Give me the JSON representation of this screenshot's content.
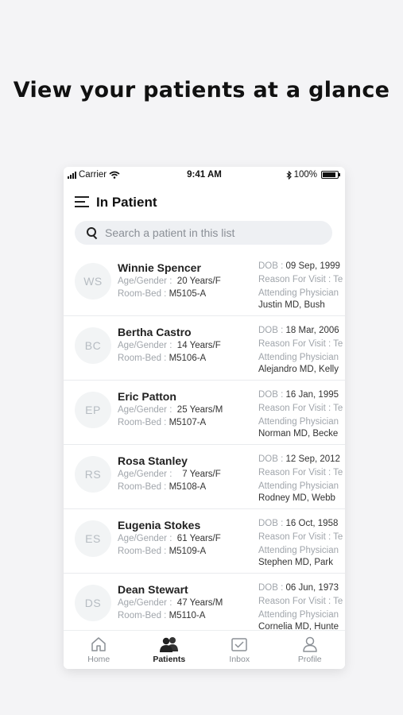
{
  "headline": "View your patients at a glance",
  "status_bar": {
    "carrier": "Carrier",
    "time": "9:41 AM",
    "battery": "100%"
  },
  "header": {
    "title": "In Patient",
    "menu_icon": "hamburger-menu-icon"
  },
  "search": {
    "placeholder": "Search a patient in this list",
    "value": ""
  },
  "labels": {
    "age_gender": "Age/Gender :",
    "room_bed": "Room-Bed :",
    "dob": "DOB :",
    "reason": "Reason For Visit : Te",
    "attending": "Attending Physician"
  },
  "patients": [
    {
      "initials": "WS",
      "name": "Winnie Spencer",
      "age_gender": "20 Years/F",
      "room_bed": "M5105-A",
      "dob": "09 Sep, 1999",
      "physician": "Justin MD, Bush"
    },
    {
      "initials": "BC",
      "name": "Bertha Castro",
      "age_gender": "14 Years/F",
      "room_bed": "M5106-A",
      "dob": "18 Mar, 2006",
      "physician": "Alejandro MD, Kelly"
    },
    {
      "initials": "EP",
      "name": "Eric Patton",
      "age_gender": "25 Years/M",
      "room_bed": "M5107-A",
      "dob": "16 Jan, 1995",
      "physician": "Norman MD, Becke"
    },
    {
      "initials": "RS",
      "name": "Rosa Stanley",
      "age_gender": "7 Years/F",
      "room_bed": "M5108-A",
      "dob": "12 Sep, 2012",
      "physician": "Rodney MD, Webb"
    },
    {
      "initials": "ES",
      "name": "Eugenia Stokes",
      "age_gender": "61 Years/F",
      "room_bed": "M5109-A",
      "dob": "16 Oct, 1958",
      "physician": "Stephen MD, Park"
    },
    {
      "initials": "DS",
      "name": "Dean Stewart",
      "age_gender": "47 Years/M",
      "room_bed": "M5110-A",
      "dob": "06 Jun, 1973",
      "physician": "Cornelia MD, Hunte"
    }
  ],
  "tabs": [
    {
      "label": "Home",
      "icon": "home-icon",
      "active": false
    },
    {
      "label": "Patients",
      "icon": "patients-icon",
      "active": true
    },
    {
      "label": "Inbox",
      "icon": "inbox-icon",
      "active": false
    },
    {
      "label": "Profile",
      "icon": "profile-icon",
      "active": false
    }
  ]
}
